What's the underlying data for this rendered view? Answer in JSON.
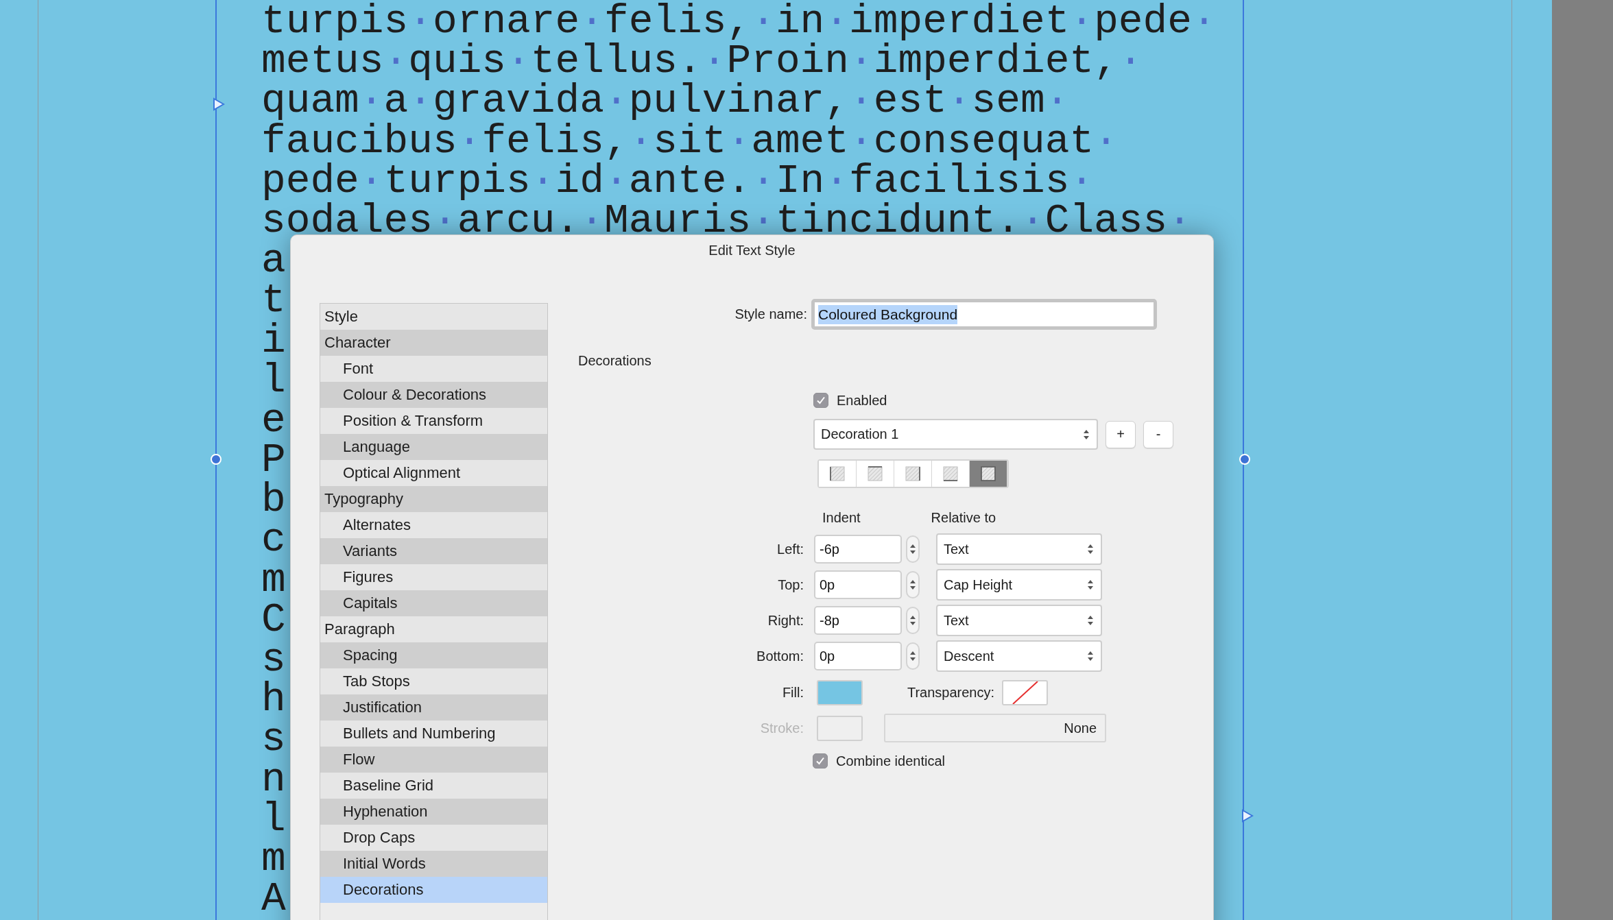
{
  "document": {
    "lines": [
      {
        "text": "turpis·ornare·felis,·in·imperdiet·pede·"
      },
      {
        "text": "metus·quis·tellus.·Proin·imperdiet,·"
      },
      {
        "text": "quam·a·gravida·pulvinar,·est·sem·"
      },
      {
        "text": "faucibus·felis,·sit·amet·consequat·"
      },
      {
        "text": "pede·turpis·id·ante.·In·facilisis·"
      },
      {
        "text": "sodales·arcu.·Mauris·tincidunt.·Class·"
      },
      {
        "text": "a"
      },
      {
        "text": "t"
      },
      {
        "text": "i"
      },
      {
        "text": "l"
      },
      {
        "text": "e"
      },
      {
        "text": "P"
      },
      {
        "text": "b"
      },
      {
        "text": "c"
      },
      {
        "text": "m"
      },
      {
        "text": "C"
      },
      {
        "text": "s"
      },
      {
        "text": "h"
      },
      {
        "text": "s"
      },
      {
        "text": "n"
      },
      {
        "text": "l"
      },
      {
        "text": "m"
      },
      {
        "text": "A"
      }
    ]
  },
  "dialog": {
    "title": "Edit Text Style",
    "sidebar": {
      "items": [
        {
          "label": "Style",
          "selected": false
        },
        {
          "label": "Character",
          "selected": false,
          "children": [
            {
              "label": "Font",
              "selected": false
            },
            {
              "label": "Colour & Decorations",
              "selected": false
            },
            {
              "label": "Position & Transform",
              "selected": false
            },
            {
              "label": "Language",
              "selected": false
            },
            {
              "label": "Optical Alignment",
              "selected": false
            }
          ]
        },
        {
          "label": "Typography",
          "selected": false,
          "children": [
            {
              "label": "Alternates",
              "selected": false
            },
            {
              "label": "Variants",
              "selected": false
            },
            {
              "label": "Figures",
              "selected": false
            },
            {
              "label": "Capitals",
              "selected": false
            }
          ]
        },
        {
          "label": "Paragraph",
          "selected": false,
          "children": [
            {
              "label": "Spacing",
              "selected": false
            },
            {
              "label": "Tab Stops",
              "selected": false
            },
            {
              "label": "Justification",
              "selected": false
            },
            {
              "label": "Bullets and Numbering",
              "selected": false
            },
            {
              "label": "Flow",
              "selected": false
            },
            {
              "label": "Baseline Grid",
              "selected": false
            },
            {
              "label": "Hyphenation",
              "selected": false
            },
            {
              "label": "Drop Caps",
              "selected": false
            },
            {
              "label": "Initial Words",
              "selected": false
            },
            {
              "label": "Decorations",
              "selected": true
            }
          ]
        }
      ]
    },
    "style_name": {
      "label": "Style name:",
      "value": "Coloured Background"
    },
    "section_title": "Decorations",
    "enabled": {
      "label": "Enabled",
      "checked": true
    },
    "decoration_select": {
      "value": "Decoration 1"
    },
    "add_button": "+",
    "remove_button": "-",
    "edge_buttons": [
      {
        "kind": "left",
        "selected": false
      },
      {
        "kind": "top",
        "selected": false
      },
      {
        "kind": "right",
        "selected": false
      },
      {
        "kind": "bottom",
        "selected": false
      },
      {
        "kind": "all",
        "selected": true
      }
    ],
    "indent_header": "Indent",
    "relative_header": "Relative to",
    "rows": [
      {
        "label": "Left:",
        "value": "-6p",
        "relative": "Text"
      },
      {
        "label": "Top:",
        "value": "0p",
        "relative": "Cap Height"
      },
      {
        "label": "Right:",
        "value": "-8p",
        "relative": "Text"
      },
      {
        "label": "Bottom:",
        "value": "0p",
        "relative": "Descent"
      }
    ],
    "fill": {
      "label": "Fill:",
      "color": "#75c5e3"
    },
    "transparency": {
      "label": "Transparency:"
    },
    "stroke": {
      "label": "Stroke:",
      "disabled": true,
      "value": "None"
    },
    "combine": {
      "label": "Combine identical",
      "checked": true
    }
  }
}
